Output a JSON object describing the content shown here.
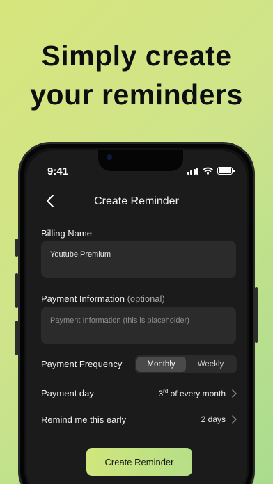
{
  "headline": [
    "Simply create",
    "your reminders"
  ],
  "status_bar": {
    "time": "9:41"
  },
  "nav": {
    "title": "Create Reminder"
  },
  "billing": {
    "label": "Billing Name",
    "value": "Youtube Premium"
  },
  "payment_info": {
    "label": "Payment Information",
    "optional": "(optional)",
    "placeholder": "Payment Information (this is placeholder)"
  },
  "frequency": {
    "label": "Payment Frequency",
    "options": [
      "Monthly",
      "Weekly"
    ],
    "selected": "Monthly"
  },
  "payment_day": {
    "label": "Payment day",
    "value_day": "3",
    "value_suffix": "rd",
    "value_rest": " of every month"
  },
  "remind": {
    "label": "Remind me this early",
    "value": "2 days"
  },
  "cta": {
    "label": "Create Reminder"
  },
  "colors": {
    "accent_start": "#cfe67c",
    "accent_end": "#b6df87",
    "screen_bg": "#1b1b1b",
    "field_bg": "#2b2b2b"
  },
  "icons": [
    "back-chevron-icon",
    "signal-icon",
    "wifi-icon",
    "battery-icon",
    "chevron-right-icon"
  ]
}
